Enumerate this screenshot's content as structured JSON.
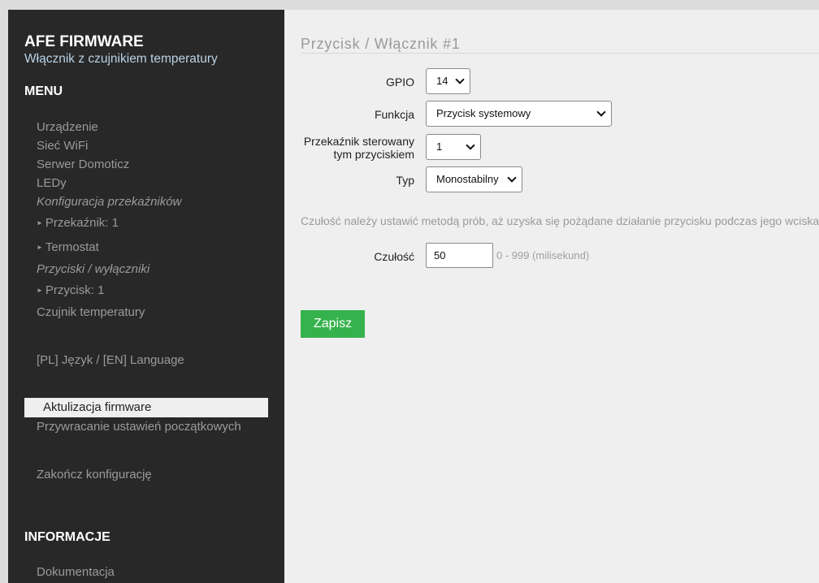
{
  "sidebar": {
    "brand_title": "AFE FIRMWARE",
    "brand_subtitle": "Włącznik z czujnikiem temperatury",
    "menu_heading": "MENU",
    "items": {
      "urzadzenie": "Urządzenie",
      "siec_wifi": "Sieć WiFi",
      "serwer_domoticz": "Serwer Domoticz",
      "ledy": "LEDy",
      "konfiguracja_przekaznikow": "Konfiguracja przekaźników",
      "przekaznik_1": "Przekaźnik: 1",
      "termostat": "Termostat",
      "przyciski_wylaczniki": "Przyciski / wyłączniki",
      "przycisk_1": "Przycisk: 1",
      "czujnik_temperatury": "Czujnik temperatury",
      "jezyk": "[PL] Język / [EN] Language",
      "aktualizacja": "Aktulizacja firmware",
      "przywracanie": "Przywracanie ustawień początkowych",
      "zakoncz": "Zakończ konfigurację"
    },
    "info_heading": "INFORMACJE",
    "info_items": {
      "dokumentacja": "Dokumentacja"
    }
  },
  "main": {
    "page_title": "Przycisk / Włącznik #1",
    "fields": {
      "gpio": {
        "label": "GPIO",
        "value": "14"
      },
      "funkcja": {
        "label": "Funkcja",
        "value": "Przycisk systemowy"
      },
      "przekaznik": {
        "label_line1": "Przekaźnik sterowany",
        "label_line2": "tym przyciskiem",
        "value": "1"
      },
      "typ": {
        "label": "Typ",
        "value": "Monostabilny"
      }
    },
    "hint": "Czułość należy ustawić metodą prób, aż uzyska się pożądane działanie przycisku podczas jego wciskania",
    "czulosc": {
      "label": "Czułość",
      "value": "50",
      "range_hint": "0 - 999 (milisekund)"
    },
    "save_label": "Zapisz"
  },
  "colors": {
    "sidebar_bg": "#282828",
    "main_bg": "#efefef",
    "accent_green": "#35b24c",
    "subtitle_blue": "#b9d2e6"
  }
}
